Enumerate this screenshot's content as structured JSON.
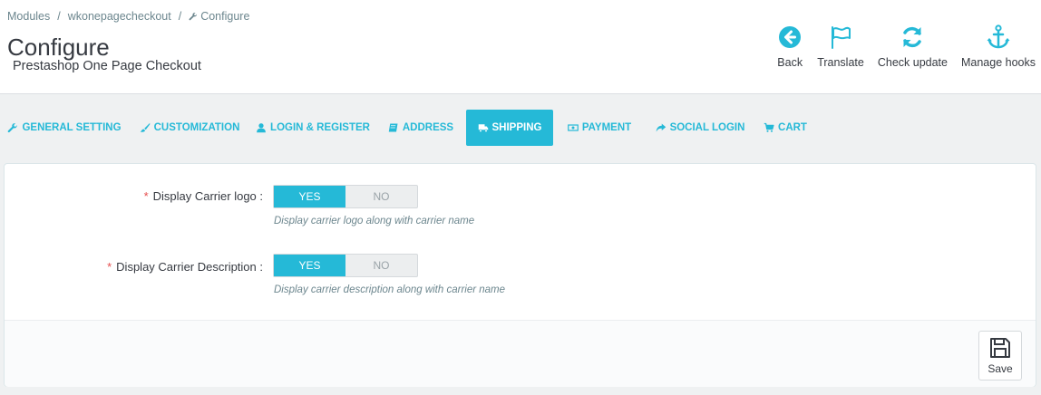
{
  "breadcrumb": {
    "item1": "Modules",
    "item2": "wkonepagecheckout",
    "item3": "Configure",
    "separator": "/",
    "item3_icon": "wrench-icon"
  },
  "header": {
    "title": "Configure",
    "subtitle": "Prestashop One Page Checkout"
  },
  "toolbar": {
    "back": {
      "label": "Back",
      "icon": "arrow-circle-left-icon"
    },
    "translate": {
      "label": "Translate",
      "icon": "flag-icon"
    },
    "check_update": {
      "label": "Check update",
      "icon": "refresh-icon"
    },
    "manage_hooks": {
      "label": "Manage hooks",
      "icon": "anchor-icon"
    }
  },
  "tabs": [
    {
      "label": "GENERAL SETTING",
      "icon": "wrench-icon",
      "active": false
    },
    {
      "label": "CUSTOMIZATION",
      "icon": "paintbrush-icon",
      "active": false
    },
    {
      "label": "LOGIN & REGISTER",
      "icon": "user-icon",
      "active": false
    },
    {
      "label": "ADDRESS",
      "icon": "book-icon",
      "active": false
    },
    {
      "label": "SHIPPING",
      "icon": "truck-icon",
      "active": true
    },
    {
      "label": "PAYMENT",
      "icon": "money-icon",
      "active": false
    },
    {
      "label": "SOCIAL LOGIN",
      "icon": "share-icon",
      "active": false
    },
    {
      "label": "CART",
      "icon": "cart-icon",
      "active": false
    }
  ],
  "form": {
    "fields": [
      {
        "required_mark": "*",
        "label": "Display Carrier logo :",
        "yes": "YES",
        "no": "NO",
        "value": "YES",
        "help": "Display carrier logo along with carrier name"
      },
      {
        "required_mark": "*",
        "label": "Display Carrier Description :",
        "yes": "YES",
        "no": "NO",
        "value": "YES",
        "help": "Display carrier description along with carrier name"
      }
    ],
    "save_label": "Save",
    "save_icon": "floppy-disk-icon"
  },
  "colors": {
    "accent": "#25b9d7",
    "required": "#e64d4d",
    "background": "#eff1f2"
  }
}
